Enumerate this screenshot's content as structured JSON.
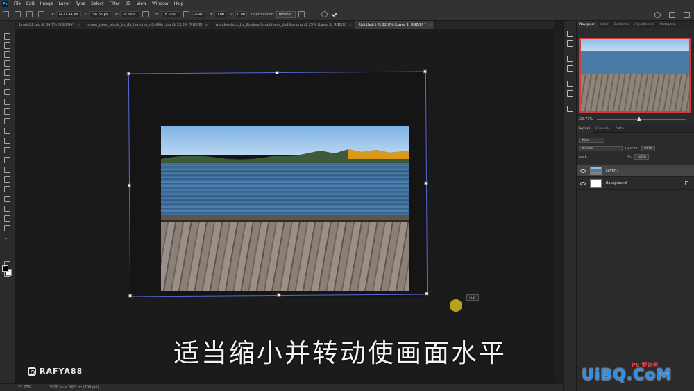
{
  "menu": {
    "app_icon": "Ps",
    "items": [
      "File",
      "Edit",
      "Image",
      "Layer",
      "Type",
      "Select",
      "Filter",
      "3D",
      "View",
      "Window",
      "Help"
    ]
  },
  "options": {
    "x_label": "X:",
    "x_value": "1421.44 px",
    "y_label": "Y:",
    "y_value": "756.86 px",
    "w_label": "W:",
    "w_value": "78.56%",
    "h_label": "H:",
    "h_value": "78.56%",
    "angle_value": "-0.41",
    "hskew_label": "H:",
    "hskew_value": "0.00",
    "vskew_label": "V:",
    "vskew_value": "0.00",
    "interp_label": "Interpolation:",
    "interp_value": "Bicubic"
  },
  "tabs": [
    {
      "label": "brook88.jpg @ 66.7% (RGB/8#)"
    },
    {
      "label": "stone_cloud_stock_by_dh_textures_d0oi86m.jpg @ 33.3% (RGB/8)"
    },
    {
      "label": "woodenstock_by_illusionofstupidness_da19pn.png @ 25% (Layer 1, RGB/8)"
    },
    {
      "label": "Untitled-1 @ 22.8% (Layer 1, RGB/8) *"
    }
  ],
  "canvas": {
    "cursor_readout": "-0.4°",
    "subtitle": "适当缩小并转动使画面水平",
    "instagram_handle": "RAFYA88"
  },
  "status": {
    "zoom": "22.77%",
    "doc_size": "3000 px x 2000 px (300 ppi)"
  },
  "navigator": {
    "tabs": [
      "Navigator",
      "Color",
      "Swatches",
      "Adjustments",
      "Histogram"
    ],
    "zoom": "22.77%"
  },
  "layers": {
    "tabs": [
      "Layers",
      "Channels",
      "Paths"
    ],
    "filter_placeholder": "Kind",
    "blend_mode": "Normal",
    "opacity_label": "Opacity:",
    "opacity_value": "100%",
    "lock_label": "Lock:",
    "fill_label": "Fill:",
    "fill_value": "100%",
    "items": [
      {
        "name": "Layer 1"
      },
      {
        "name": "Background"
      }
    ]
  },
  "watermark": {
    "site": "UiBQ.CoM",
    "ps_mark": "PS 爱好者"
  }
}
